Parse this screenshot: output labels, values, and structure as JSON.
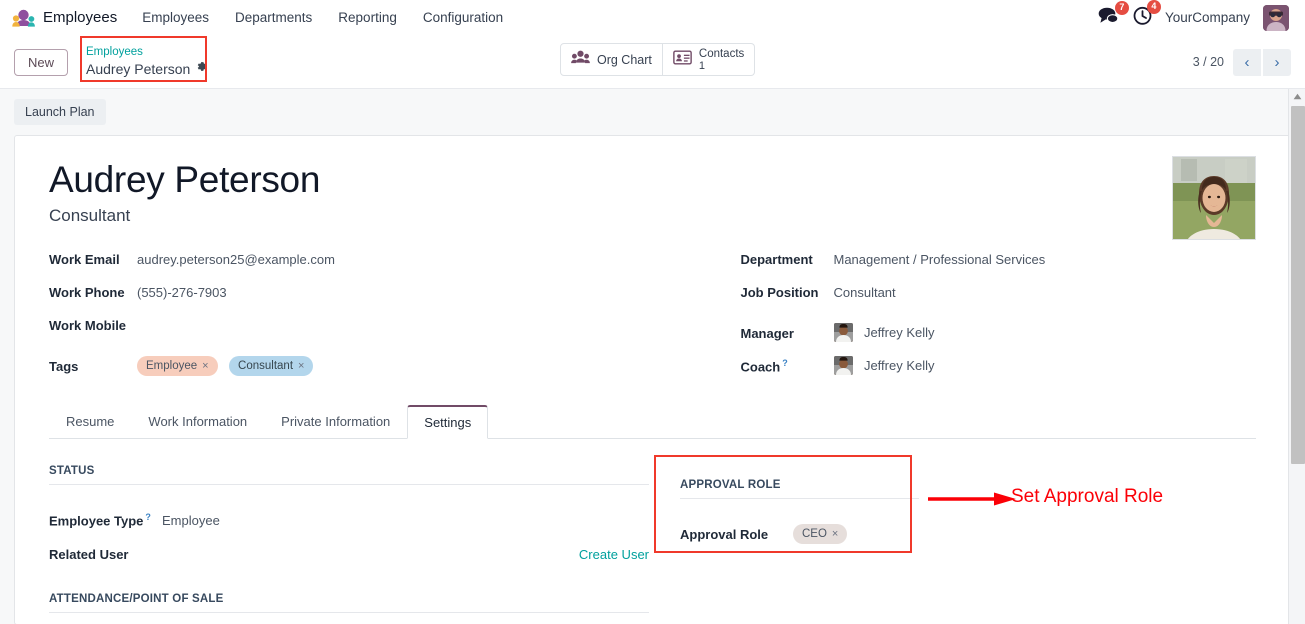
{
  "navbar": {
    "app_icon": "employees-app-icon",
    "app_name": "Employees",
    "menus": [
      "Employees",
      "Departments",
      "Reporting",
      "Configuration"
    ],
    "messages_icon": "messages-icon",
    "messages_badge": "7",
    "activities_icon": "activities-clock-icon",
    "activities_badge": "4",
    "company": "YourCompany",
    "avatar": "user-avatar"
  },
  "control_panel": {
    "new_label": "New",
    "breadcrumb_parent": "Employees",
    "breadcrumb_current": "Audrey Peterson",
    "gear_icon": "gear-icon",
    "stat_buttons": [
      {
        "icon": "org-chart-people-icon",
        "label": "Org Chart",
        "value": ""
      },
      {
        "icon": "contacts-card-icon",
        "label": "Contacts",
        "value": "1"
      }
    ],
    "pager_count": "3 / 20",
    "prev_icon": "chevron-left-icon",
    "next_icon": "chevron-right-icon"
  },
  "sheet": {
    "launch_plan_label": "Launch Plan",
    "employee_name": "Audrey Peterson",
    "job_title": "Consultant",
    "photo": "employee-photo",
    "left_fields": [
      {
        "label": "Work Email",
        "value": "audrey.peterson25@example.com"
      },
      {
        "label": "Work Phone",
        "value": "(555)-276-7903"
      },
      {
        "label": "Work Mobile",
        "value": ""
      }
    ],
    "tags_label": "Tags",
    "tags": [
      {
        "name": "Employee",
        "style": "tag-employee",
        "remove": "×"
      },
      {
        "name": "Consultant",
        "style": "tag-consultant",
        "remove": "×"
      }
    ],
    "right_fields": [
      {
        "label": "Department",
        "value": "Management / Professional Services"
      },
      {
        "label": "Job Position",
        "value": "Consultant"
      }
    ],
    "manager_label": "Manager",
    "manager_name": "Jeffrey Kelly",
    "coach_label": "Coach",
    "coach_help": "?",
    "coach_name": "Jeffrey Kelly"
  },
  "tabs": [
    {
      "label": "Resume",
      "active": false
    },
    {
      "label": "Work Information",
      "active": false
    },
    {
      "label": "Private Information",
      "active": false
    },
    {
      "label": "Settings",
      "active": true
    }
  ],
  "settings_tab": {
    "status_section_title": "STATUS",
    "employee_type_label": "Employee Type",
    "employee_type_help": "?",
    "employee_type_value": "Employee",
    "related_user_label": "Related User",
    "related_user_value": "",
    "create_user_link": "Create User",
    "attendance_section_title": "ATTENDANCE/POINT OF SALE",
    "approval_section_title": "APPROVAL ROLE",
    "approval_role_label": "Approval Role",
    "approval_role_tag": "CEO",
    "approval_role_tag_remove": "×"
  },
  "annotation": {
    "text": "Set Approval Role",
    "color": "#fb0007",
    "arrow": "red-arrow-icon"
  },
  "scrollbar": {
    "up_arrow_icon": "scroll-up-arrow-icon"
  }
}
